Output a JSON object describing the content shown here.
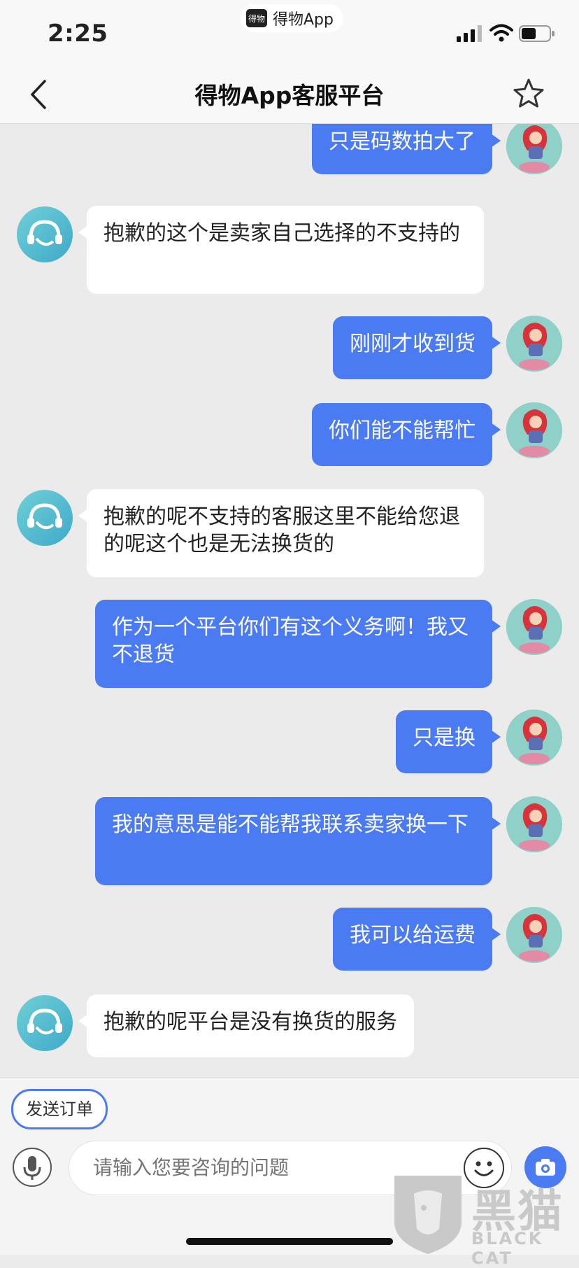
{
  "status_bar": {
    "time": "2:25",
    "app_label": "得物App",
    "app_logo_text": "得物"
  },
  "nav": {
    "title": "得物App客服平台",
    "back_icon": "chevron-left-icon",
    "favorite_icon": "star-icon"
  },
  "messages": [
    {
      "from": "user",
      "text": "只是码数拍大了"
    },
    {
      "from": "agent",
      "text": "抱歉的这个是卖家自己选择的不支持的"
    },
    {
      "from": "user",
      "text": "刚刚才收到货"
    },
    {
      "from": "user",
      "text": "你们能不能帮忙"
    },
    {
      "from": "agent",
      "text": "抱歉的呢不支持的客服这里不能给您退的呢这个也是无法换货的"
    },
    {
      "from": "user",
      "text": "作为一个平台你们有这个义务啊！我又不退货"
    },
    {
      "from": "user",
      "text": "只是换"
    },
    {
      "from": "user",
      "text": "我的意思是能不能帮我联系卖家换一下"
    },
    {
      "from": "user",
      "text": "我可以给运费"
    },
    {
      "from": "agent",
      "text": "抱歉的呢平台是没有换货的服务"
    }
  ],
  "composer": {
    "send_order_label": "发送订单",
    "placeholder": "请输入您要咨询的问题",
    "mic_icon": "microphone-icon",
    "emoji_icon": "emoji-icon",
    "camera_icon": "camera-icon"
  },
  "watermark": {
    "cn": "黑猫",
    "en": "BLACK CAT"
  },
  "colors": {
    "user_bubble": "#4b7bf2",
    "agent_bubble": "#ffffff",
    "background": "#ebebeb"
  }
}
